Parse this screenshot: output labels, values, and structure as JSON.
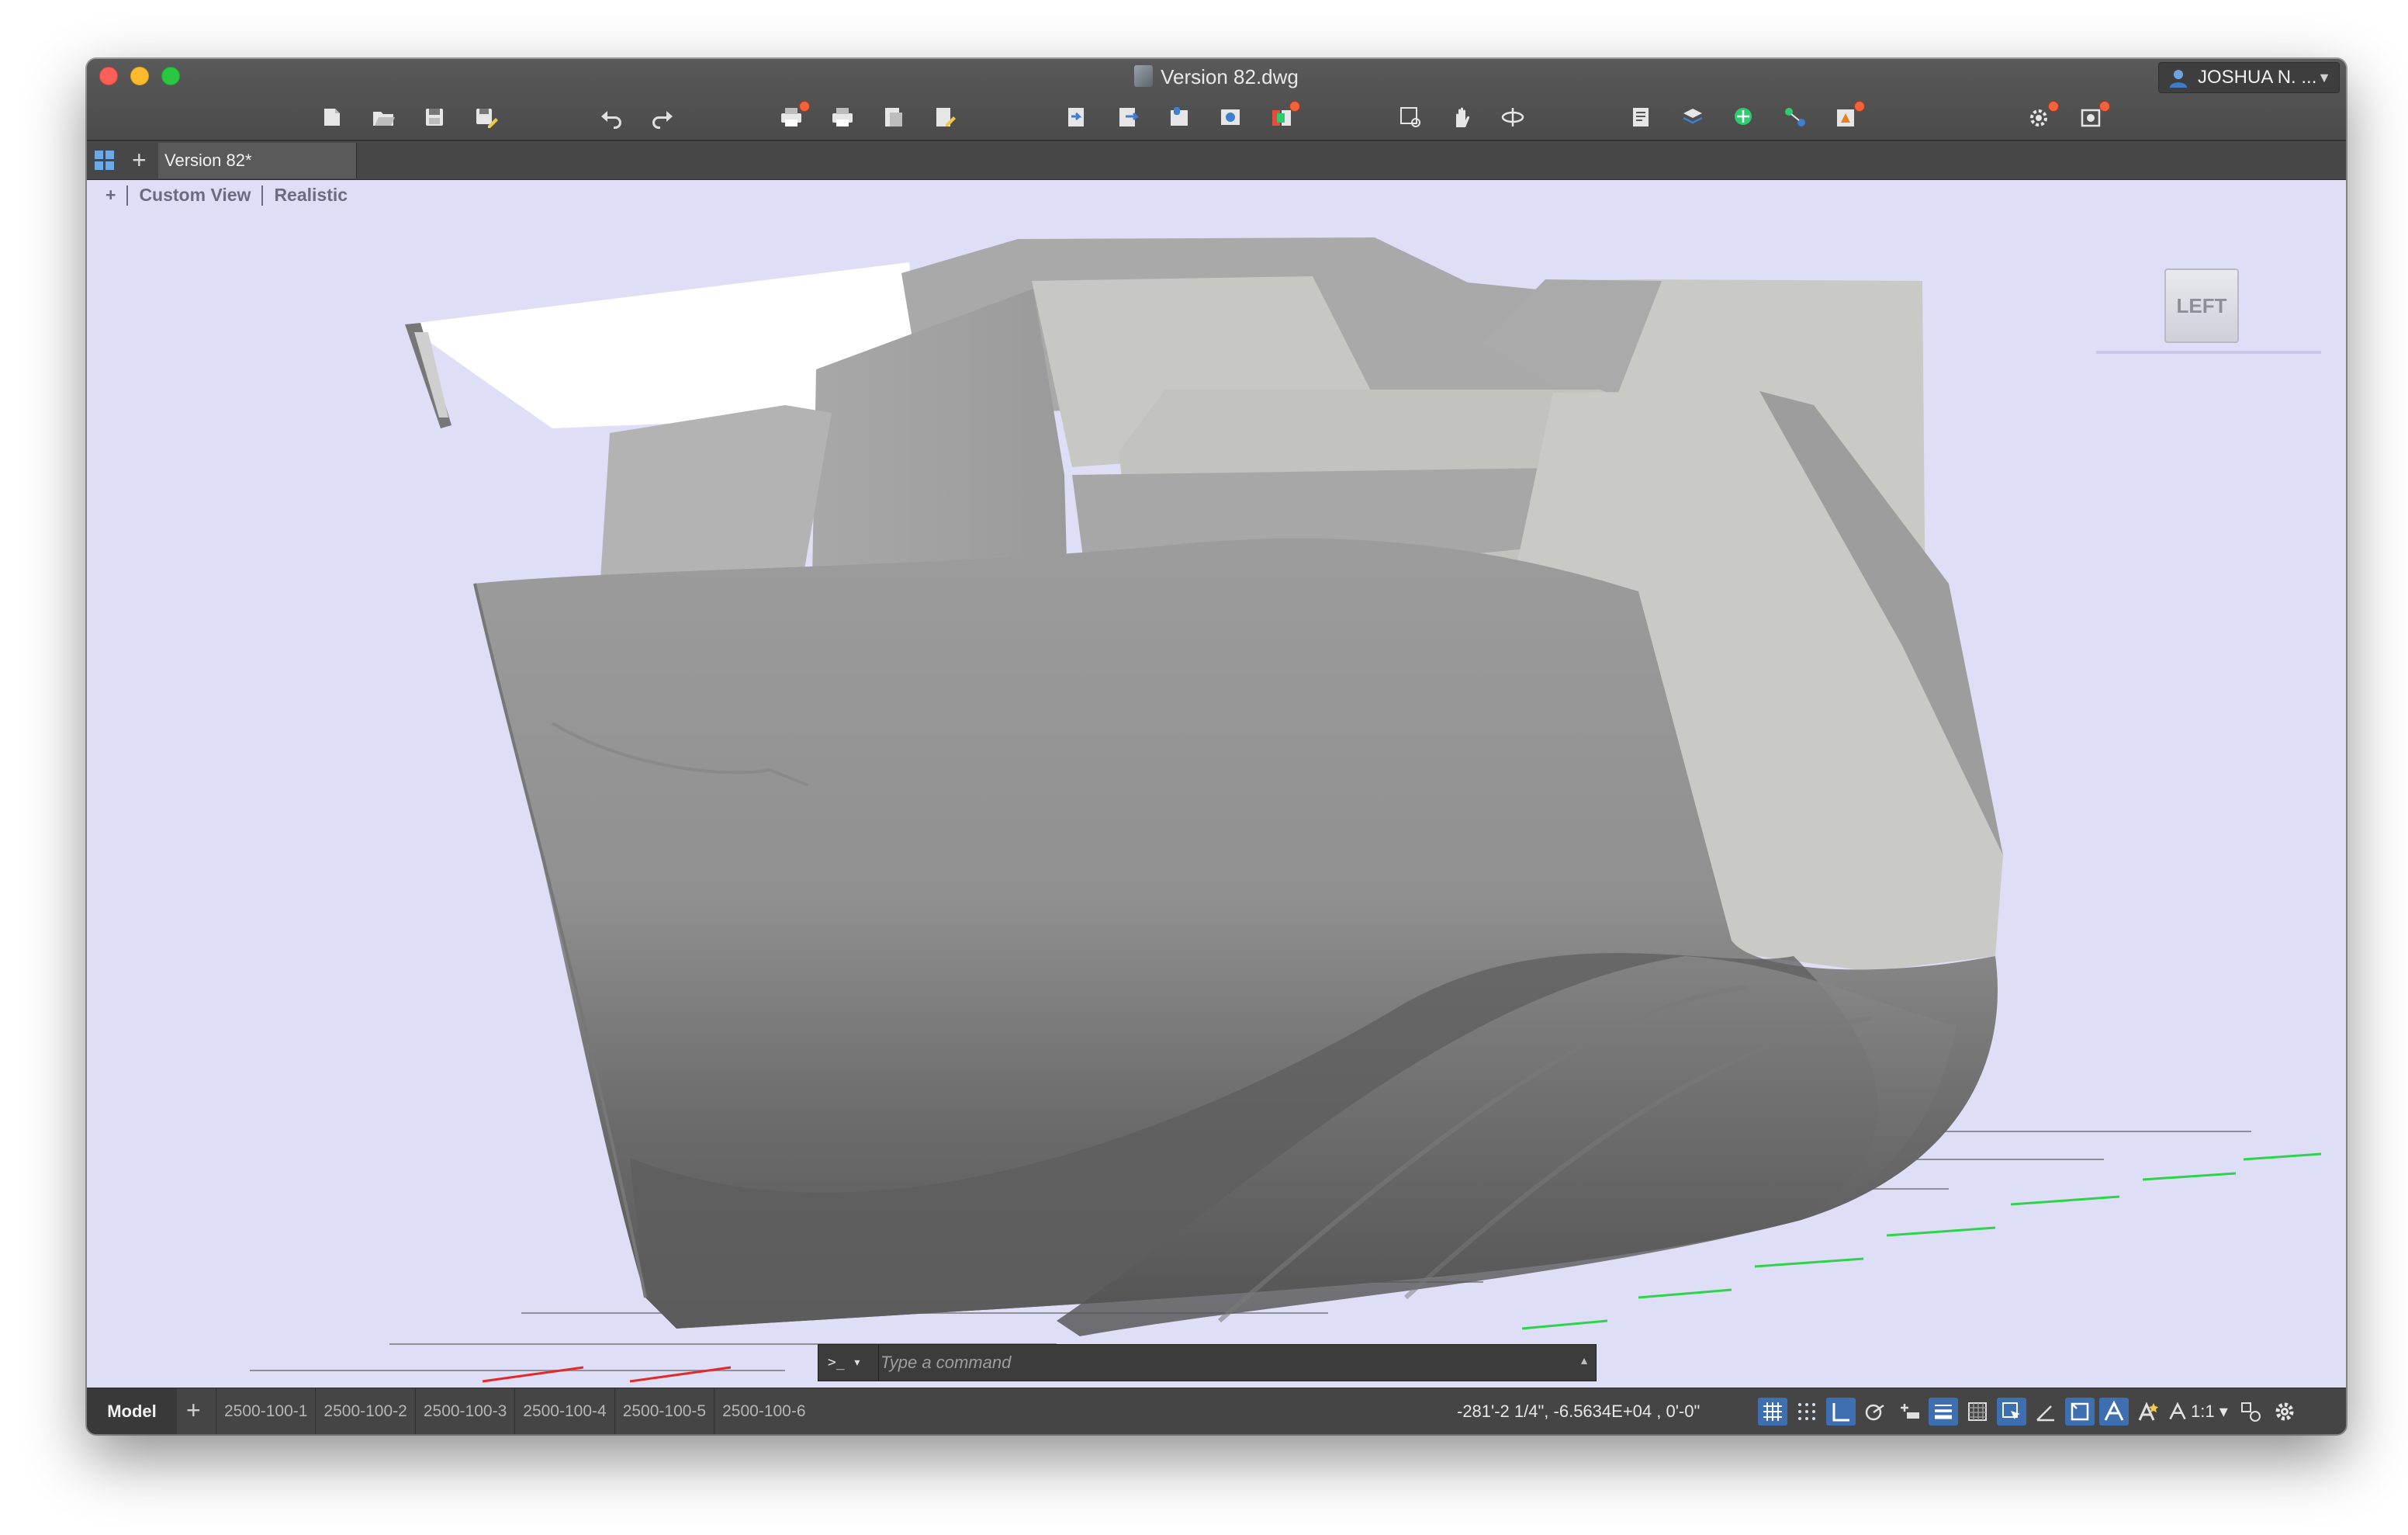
{
  "window": {
    "title": "Version 82.dwg",
    "user_name": "JOSHUA N. ..."
  },
  "toolbar": {
    "groups": [
      [
        "new-icon",
        "open-icon",
        "save-icon",
        "save-as-icon"
      ],
      [
        "undo-icon",
        "redo-icon"
      ],
      [
        "plot-icon",
        "batch-plot-icon",
        "page-setup-icon",
        "publish-icon"
      ],
      [
        "import-icon",
        "export-icon",
        "attach-icon",
        "share-icon",
        "references-icon"
      ],
      [
        "zoom-window-icon",
        "pan-icon",
        "orbit-icon"
      ],
      [
        "properties-icon",
        "layer-icon",
        "coordinate-icon",
        "connect-icon",
        "notify-icon"
      ],
      [
        "settings-icon",
        "render-icon"
      ]
    ]
  },
  "tabs": {
    "active_document": "Version 82*"
  },
  "viewport": {
    "controls": {
      "plus": "+",
      "view": "Custom View",
      "visual_style": "Realistic"
    },
    "viewcube_face": "LEFT",
    "background_color": "#dedff7"
  },
  "command_line": {
    "prompt": ">_ ▾",
    "placeholder": "Type a command"
  },
  "status_bar": {
    "model_tab": "Model",
    "layout_tabs": [
      "2500-100-1",
      "2500-100-2",
      "2500-100-3",
      "2500-100-4",
      "2500-100-5",
      "2500-100-6"
    ],
    "coordinates": "-281'-2 1/4\", -6.5634E+04 , 0'-0\"",
    "scale": "1:1 ▾",
    "accent_color": "#3e6fb1"
  }
}
